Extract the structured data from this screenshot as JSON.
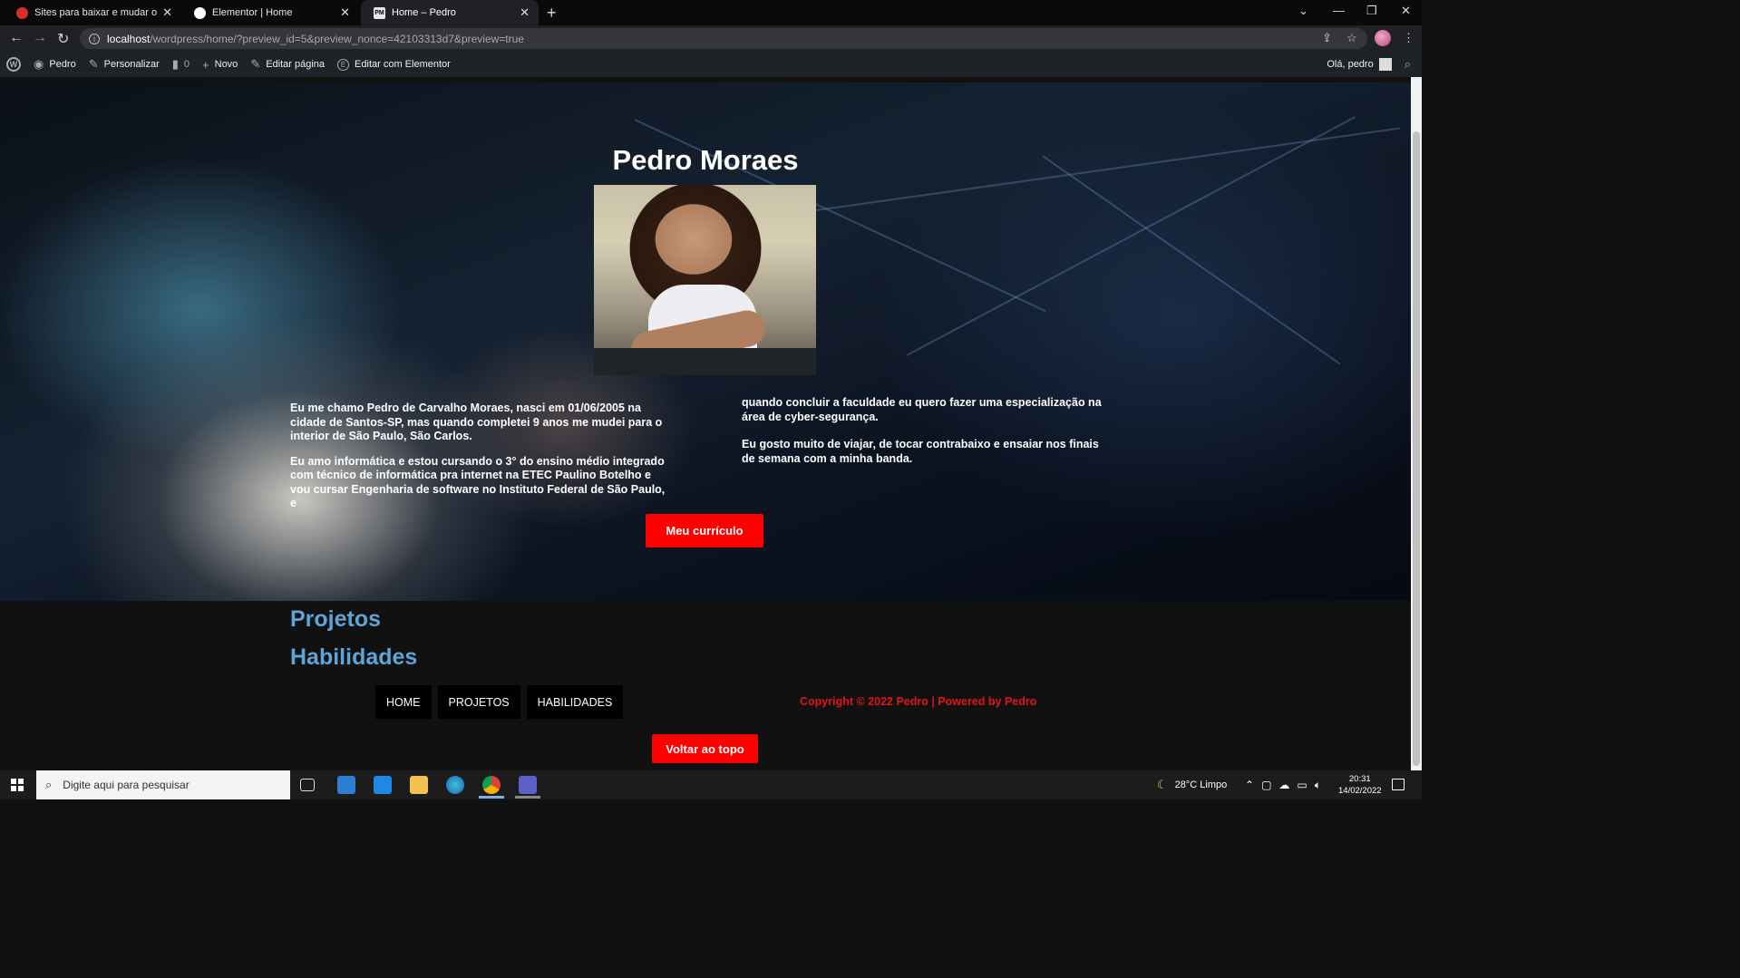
{
  "browser": {
    "tabs": [
      {
        "title": "Sites para baixar e mudar o pape",
        "favicon_color": "#d93025",
        "active": false
      },
      {
        "title": "Elementor | Home",
        "favicon_color": "#ffffff",
        "active": false
      },
      {
        "title": "Home – Pedro",
        "favicon_text": "PM",
        "favicon_color": "#e8e8e8",
        "active": true
      }
    ],
    "url_host": "localhost",
    "url_path": "/wordpress/home/?preview_id=5&preview_nonce=42103313d7&preview=true"
  },
  "admin_bar": {
    "site": "Pedro",
    "customize": "Personalizar",
    "comments": "0",
    "new": "Novo",
    "edit_page": "Editar página",
    "edit_elementor": "Editar com Elementor",
    "greeting": "Olá, pedro"
  },
  "hero": {
    "title": "Pedro Moraes",
    "bio_left": [
      "Eu me chamo Pedro de Carvalho Moraes, nasci em 01/06/2005 na cidade de Santos-SP, mas quando completei 9 anos me mudei para o interior de São Paulo, São Carlos.",
      "Eu amo informática e estou cursando o 3° do ensino médio integrado com técnico de informática pra internet na ETEC Paulino Botelho e vou cursar Engenharia de software no Instituto Federal de São Paulo, e"
    ],
    "bio_right": [
      "quando concluir a faculdade eu quero fazer uma especialização na área de cyber-segurança.",
      "Eu gosto muito de viajar, de tocar contrabaixo e ensaiar nos finais de semana com a minha banda."
    ],
    "cv_button": "Meu currículo"
  },
  "footer": {
    "links": [
      "Projetos",
      "Habilidades"
    ],
    "menu": [
      "HOME",
      "PROJETOS",
      "HABILIDADES"
    ],
    "copyright": "Copyright © 2022 Pedro | Powered by Pedro",
    "back_to_top": "Voltar ao topo"
  },
  "taskbar": {
    "search_placeholder": "Digite aqui para pesquisar",
    "weather": "28°C  Limpo",
    "time": "20:31",
    "date": "14/02/2022"
  },
  "colors": {
    "accent_red": "#ff0000",
    "link_blue": "#5ea4d6",
    "copyright_red": "#e0151a"
  }
}
